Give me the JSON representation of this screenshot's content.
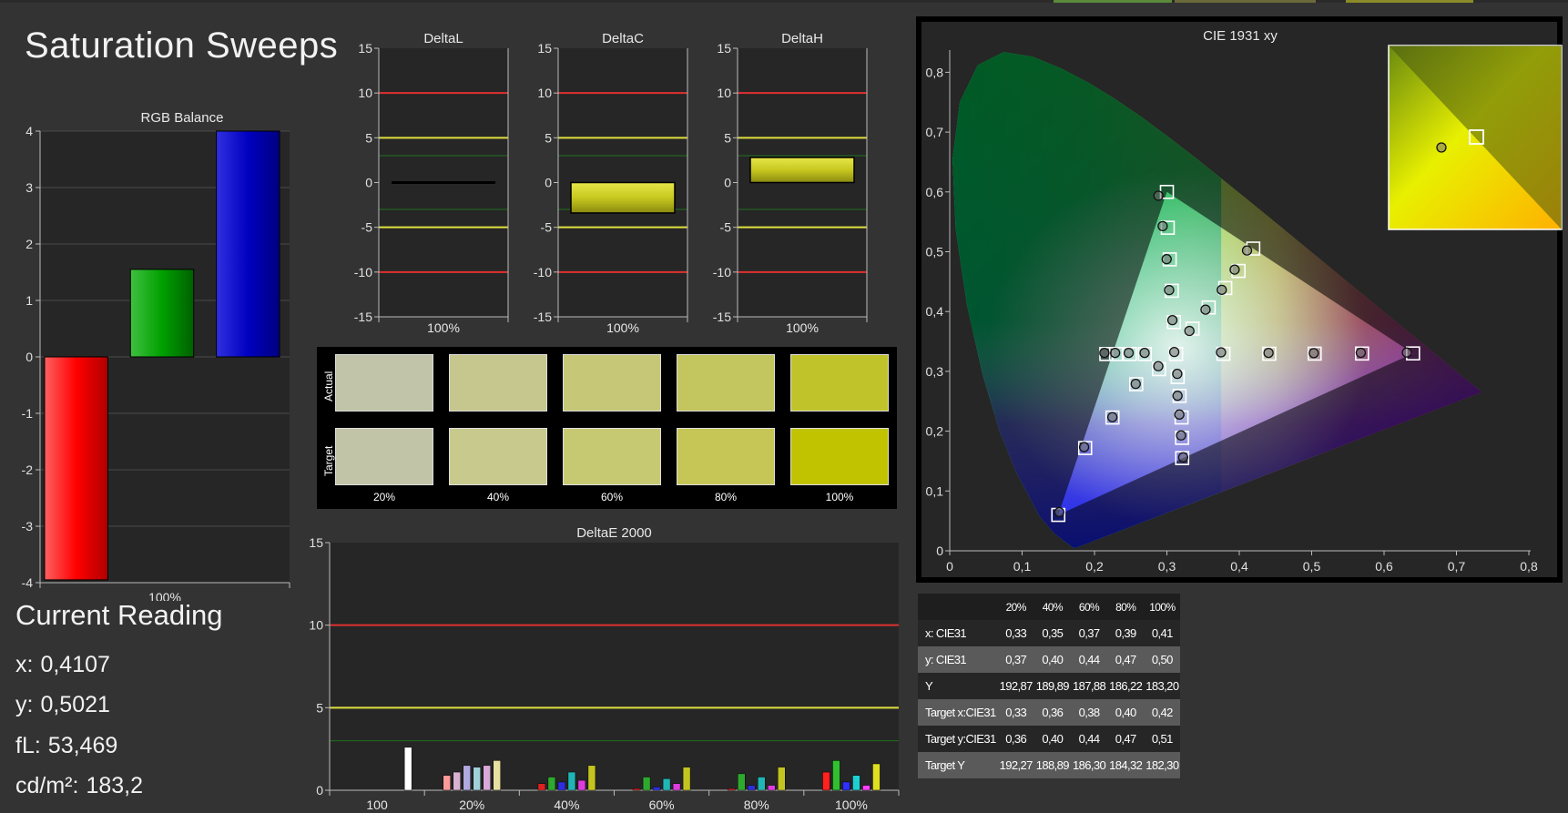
{
  "page_title": "Saturation Sweeps",
  "rgb_balance": {
    "title": "RGB Balance",
    "x_label": "100%",
    "ticks": [
      "4",
      "3",
      "2",
      "1",
      "0",
      "-1",
      "-2",
      "-3",
      "-4"
    ],
    "bars": [
      {
        "name": "red",
        "value": -3.95,
        "color": "#ff0000"
      },
      {
        "name": "green",
        "value": 1.55,
        "color": "#00a000"
      },
      {
        "name": "blue",
        "value": 4.0,
        "color": "#0000c0"
      }
    ],
    "ylim": [
      -4,
      4
    ]
  },
  "delta_charts": [
    {
      "title": "DeltaL",
      "x_label": "100%",
      "value": 0.1,
      "ticks": [
        "15",
        "10",
        "5",
        "0",
        "-5",
        "-10",
        "-15"
      ]
    },
    {
      "title": "DeltaC",
      "x_label": "100%",
      "value": -3.4,
      "ticks": [
        "15",
        "10",
        "5",
        "0",
        "-5",
        "-10",
        "-15"
      ]
    },
    {
      "title": "DeltaH",
      "x_label": "100%",
      "value": 2.8,
      "ticks": [
        "15",
        "10",
        "5",
        "0",
        "-5",
        "-10",
        "-15"
      ]
    }
  ],
  "swatches": {
    "actual_label": "Actual",
    "target_label": "Target",
    "labels": [
      "20%",
      "40%",
      "60%",
      "80%",
      "100%"
    ],
    "actual_colors": [
      "#c1c4a8",
      "#c6c78e",
      "#c6c878",
      "#c3c55e",
      "#c0c42a"
    ],
    "target_colors": [
      "#c2c4a8",
      "#c8c98d",
      "#c7c972",
      "#c6c657",
      "#c2c300"
    ]
  },
  "deltae_chart": {
    "title": "DeltaE 2000",
    "ticks": [
      "15",
      "10",
      "5",
      "0"
    ],
    "groups": [
      "100",
      "20%",
      "40%",
      "60%",
      "80%",
      "100%"
    ],
    "colors": [
      "#ff2020",
      "#30c030",
      "#3030ff",
      "#20d0d0",
      "#ff40ff",
      "#e0e020"
    ],
    "group_values": [
      [
        2.6
      ],
      [
        0.9,
        1.1,
        1.5,
        1.4,
        1.5,
        1.8
      ],
      [
        0.4,
        0.8,
        0.5,
        1.1,
        0.6,
        1.5
      ],
      [
        0.1,
        0.8,
        0.2,
        0.7,
        0.4,
        1.4
      ],
      [
        0.1,
        1.0,
        0.3,
        0.8,
        0.3,
        1.4
      ],
      [
        1.1,
        1.8,
        0.5,
        0.9,
        0.3,
        1.6
      ]
    ]
  },
  "chart_data": {
    "type": "scatter",
    "title": "CIE 1931 xy",
    "xlim": [
      0,
      0.8
    ],
    "ylim": [
      0,
      0.85
    ],
    "x_ticks": [
      "0",
      "0,1",
      "0,2",
      "0,3",
      "0,4",
      "0,5",
      "0,6",
      "0,7",
      "0,8"
    ],
    "y_ticks": [
      "0",
      "0,1",
      "0,2",
      "0,3",
      "0,4",
      "0,5",
      "0,6",
      "0,7",
      "0,8"
    ],
    "gamut_triangle": [
      [
        0.64,
        0.33
      ],
      [
        0.3,
        0.6
      ],
      [
        0.15,
        0.06
      ]
    ],
    "series": [
      {
        "kind": "target",
        "points": [
          [
            0.3127,
            0.329
          ],
          [
            0.3781,
            0.3293
          ],
          [
            0.4414,
            0.3294
          ],
          [
            0.5041,
            0.3296
          ],
          [
            0.5696,
            0.3298
          ],
          [
            0.64,
            0.33
          ],
          [
            0.3097,
            0.3823
          ],
          [
            0.3068,
            0.4347
          ],
          [
            0.3039,
            0.4872
          ],
          [
            0.3012,
            0.5401
          ],
          [
            0.3,
            0.6
          ],
          [
            0.2891,
            0.3037
          ],
          [
            0.2576,
            0.2785
          ],
          [
            0.2248,
            0.2228
          ],
          [
            0.1871,
            0.1718
          ],
          [
            0.15,
            0.06
          ],
          [
            0.2695,
            0.329
          ],
          [
            0.2488,
            0.329
          ],
          [
            0.2298,
            0.329
          ],
          [
            0.2163,
            0.329
          ],
          [
            0.3149,
            0.2905
          ],
          [
            0.3175,
            0.259
          ],
          [
            0.3203,
            0.2229
          ],
          [
            0.3209,
            0.1888
          ],
          [
            0.3211,
            0.155
          ],
          [
            0.3354,
            0.3714
          ],
          [
            0.3577,
            0.4068
          ],
          [
            0.3806,
            0.4393
          ],
          [
            0.3989,
            0.4679
          ],
          [
            0.4193,
            0.5053
          ]
        ]
      },
      {
        "kind": "measured",
        "points": [
          [
            0.3102,
            0.3324
          ],
          [
            0.3748,
            0.3318
          ],
          [
            0.4404,
            0.3309
          ],
          [
            0.5029,
            0.3305
          ],
          [
            0.5678,
            0.3311
          ],
          [
            0.6315,
            0.3315
          ],
          [
            0.3076,
            0.3856
          ],
          [
            0.3031,
            0.4359
          ],
          [
            0.2997,
            0.4876
          ],
          [
            0.2942,
            0.5428
          ],
          [
            0.2883,
            0.5936
          ],
          [
            0.2881,
            0.3086
          ],
          [
            0.2569,
            0.2791
          ],
          [
            0.2247,
            0.2234
          ],
          [
            0.1856,
            0.1734
          ],
          [
            0.1514,
            0.0646
          ],
          [
            0.2692,
            0.3309
          ],
          [
            0.2472,
            0.3309
          ],
          [
            0.2285,
            0.3309
          ],
          [
            0.2137,
            0.3309
          ],
          [
            0.3143,
            0.2958
          ],
          [
            0.3147,
            0.2592
          ],
          [
            0.3172,
            0.2278
          ],
          [
            0.3196,
            0.1929
          ],
          [
            0.3225,
            0.1563
          ],
          [
            0.3311,
            0.3676
          ],
          [
            0.3534,
            0.4032
          ],
          [
            0.3758,
            0.4363
          ],
          [
            0.3936,
            0.4701
          ],
          [
            0.4107,
            0.5021
          ]
        ]
      }
    ],
    "inset": {
      "target": [
        0.4193,
        0.5053
      ],
      "measured": [
        0.4107,
        0.5021
      ]
    }
  },
  "current_reading": {
    "title": "Current Reading",
    "lines": [
      {
        "label": "x:",
        "value": "0,4107"
      },
      {
        "label": "y:",
        "value": "0,5021"
      },
      {
        "label": "fL:",
        "value": "53,469"
      },
      {
        "label": "cd/m²:",
        "value": "183,2"
      }
    ]
  },
  "readings_table": {
    "columns": [
      "20%",
      "40%",
      "60%",
      "80%",
      "100%"
    ],
    "rows": [
      {
        "label": "x: CIE31",
        "values": [
          "0,33",
          "0,35",
          "0,37",
          "0,39",
          "0,41"
        ]
      },
      {
        "label": "y: CIE31",
        "values": [
          "0,37",
          "0,40",
          "0,44",
          "0,47",
          "0,50"
        ]
      },
      {
        "label": "Y",
        "values": [
          "192,87",
          "189,89",
          "187,88",
          "186,22",
          "183,20"
        ]
      },
      {
        "label": "Target x:CIE31",
        "values": [
          "0,33",
          "0,36",
          "0,38",
          "0,40",
          "0,42"
        ]
      },
      {
        "label": "Target y:CIE31",
        "values": [
          "0,36",
          "0,40",
          "0,44",
          "0,47",
          "0,51"
        ]
      },
      {
        "label": "Target Y",
        "values": [
          "192,27",
          "188,89",
          "186,30",
          "184,32",
          "182,30"
        ]
      }
    ]
  }
}
